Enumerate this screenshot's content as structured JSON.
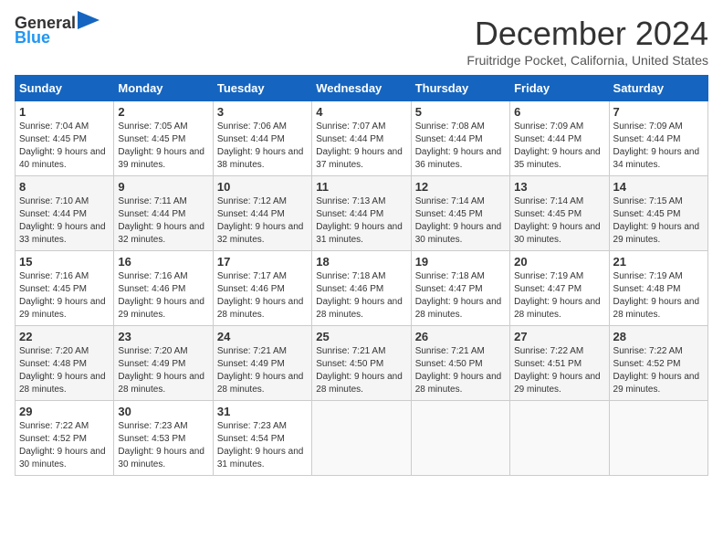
{
  "header": {
    "logo_line1": "General",
    "logo_line2": "Blue",
    "month": "December 2024",
    "location": "Fruitridge Pocket, California, United States"
  },
  "weekdays": [
    "Sunday",
    "Monday",
    "Tuesday",
    "Wednesday",
    "Thursday",
    "Friday",
    "Saturday"
  ],
  "weeks": [
    [
      {
        "day": "1",
        "sunrise": "7:04 AM",
        "sunset": "4:45 PM",
        "daylight": "9 hours and 40 minutes."
      },
      {
        "day": "2",
        "sunrise": "7:05 AM",
        "sunset": "4:45 PM",
        "daylight": "9 hours and 39 minutes."
      },
      {
        "day": "3",
        "sunrise": "7:06 AM",
        "sunset": "4:44 PM",
        "daylight": "9 hours and 38 minutes."
      },
      {
        "day": "4",
        "sunrise": "7:07 AM",
        "sunset": "4:44 PM",
        "daylight": "9 hours and 37 minutes."
      },
      {
        "day": "5",
        "sunrise": "7:08 AM",
        "sunset": "4:44 PM",
        "daylight": "9 hours and 36 minutes."
      },
      {
        "day": "6",
        "sunrise": "7:09 AM",
        "sunset": "4:44 PM",
        "daylight": "9 hours and 35 minutes."
      },
      {
        "day": "7",
        "sunrise": "7:09 AM",
        "sunset": "4:44 PM",
        "daylight": "9 hours and 34 minutes."
      }
    ],
    [
      {
        "day": "8",
        "sunrise": "7:10 AM",
        "sunset": "4:44 PM",
        "daylight": "9 hours and 33 minutes."
      },
      {
        "day": "9",
        "sunrise": "7:11 AM",
        "sunset": "4:44 PM",
        "daylight": "9 hours and 32 minutes."
      },
      {
        "day": "10",
        "sunrise": "7:12 AM",
        "sunset": "4:44 PM",
        "daylight": "9 hours and 32 minutes."
      },
      {
        "day": "11",
        "sunrise": "7:13 AM",
        "sunset": "4:44 PM",
        "daylight": "9 hours and 31 minutes."
      },
      {
        "day": "12",
        "sunrise": "7:14 AM",
        "sunset": "4:45 PM",
        "daylight": "9 hours and 30 minutes."
      },
      {
        "day": "13",
        "sunrise": "7:14 AM",
        "sunset": "4:45 PM",
        "daylight": "9 hours and 30 minutes."
      },
      {
        "day": "14",
        "sunrise": "7:15 AM",
        "sunset": "4:45 PM",
        "daylight": "9 hours and 29 minutes."
      }
    ],
    [
      {
        "day": "15",
        "sunrise": "7:16 AM",
        "sunset": "4:45 PM",
        "daylight": "9 hours and 29 minutes."
      },
      {
        "day": "16",
        "sunrise": "7:16 AM",
        "sunset": "4:46 PM",
        "daylight": "9 hours and 29 minutes."
      },
      {
        "day": "17",
        "sunrise": "7:17 AM",
        "sunset": "4:46 PM",
        "daylight": "9 hours and 28 minutes."
      },
      {
        "day": "18",
        "sunrise": "7:18 AM",
        "sunset": "4:46 PM",
        "daylight": "9 hours and 28 minutes."
      },
      {
        "day": "19",
        "sunrise": "7:18 AM",
        "sunset": "4:47 PM",
        "daylight": "9 hours and 28 minutes."
      },
      {
        "day": "20",
        "sunrise": "7:19 AM",
        "sunset": "4:47 PM",
        "daylight": "9 hours and 28 minutes."
      },
      {
        "day": "21",
        "sunrise": "7:19 AM",
        "sunset": "4:48 PM",
        "daylight": "9 hours and 28 minutes."
      }
    ],
    [
      {
        "day": "22",
        "sunrise": "7:20 AM",
        "sunset": "4:48 PM",
        "daylight": "9 hours and 28 minutes."
      },
      {
        "day": "23",
        "sunrise": "7:20 AM",
        "sunset": "4:49 PM",
        "daylight": "9 hours and 28 minutes."
      },
      {
        "day": "24",
        "sunrise": "7:21 AM",
        "sunset": "4:49 PM",
        "daylight": "9 hours and 28 minutes."
      },
      {
        "day": "25",
        "sunrise": "7:21 AM",
        "sunset": "4:50 PM",
        "daylight": "9 hours and 28 minutes."
      },
      {
        "day": "26",
        "sunrise": "7:21 AM",
        "sunset": "4:50 PM",
        "daylight": "9 hours and 28 minutes."
      },
      {
        "day": "27",
        "sunrise": "7:22 AM",
        "sunset": "4:51 PM",
        "daylight": "9 hours and 29 minutes."
      },
      {
        "day": "28",
        "sunrise": "7:22 AM",
        "sunset": "4:52 PM",
        "daylight": "9 hours and 29 minutes."
      }
    ],
    [
      {
        "day": "29",
        "sunrise": "7:22 AM",
        "sunset": "4:52 PM",
        "daylight": "9 hours and 30 minutes."
      },
      {
        "day": "30",
        "sunrise": "7:23 AM",
        "sunset": "4:53 PM",
        "daylight": "9 hours and 30 minutes."
      },
      {
        "day": "31",
        "sunrise": "7:23 AM",
        "sunset": "4:54 PM",
        "daylight": "9 hours and 31 minutes."
      },
      null,
      null,
      null,
      null
    ]
  ]
}
